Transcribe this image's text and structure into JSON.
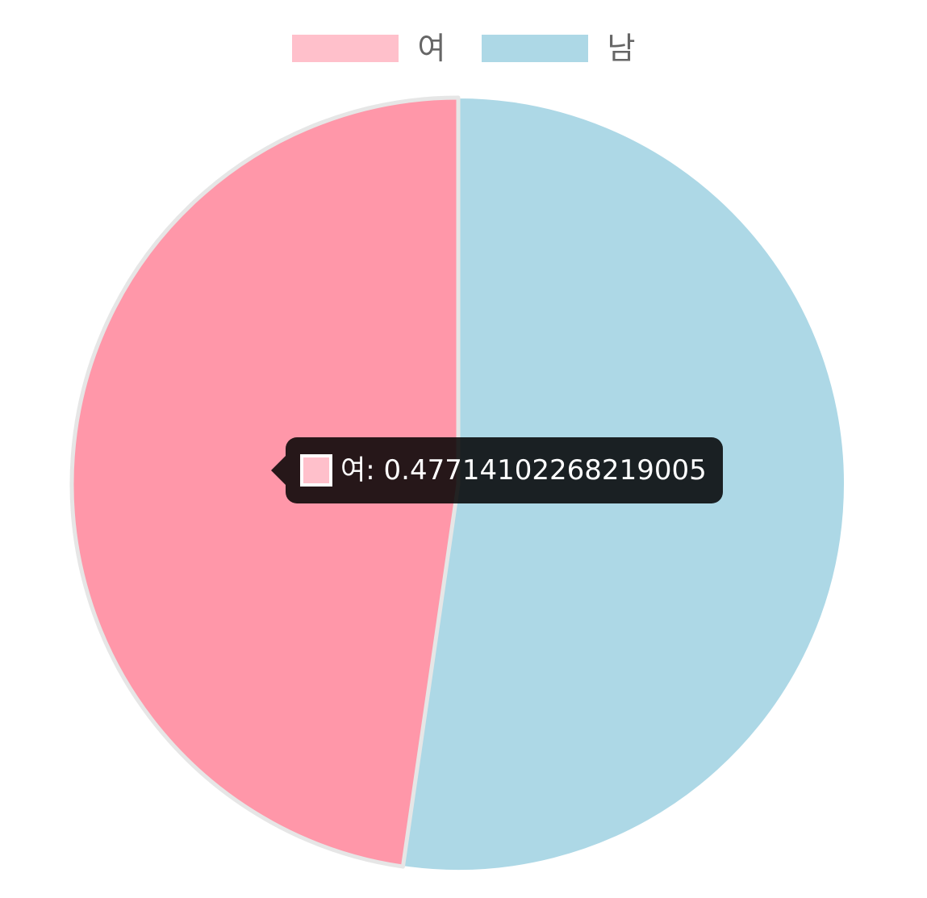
{
  "chart_data": {
    "type": "pie",
    "categories": [
      "여",
      "남"
    ],
    "values": [
      0.47714102268219005,
      0.52285897731781
    ],
    "colors": [
      "#ff97a9",
      "#add8e6"
    ],
    "legend_colors": [
      "#ffc0cb",
      "#add8e6"
    ],
    "border_color": "#e6e6e6",
    "start_angle_deg": -90,
    "direction": "counterclockwise",
    "legend_position": "top"
  },
  "tooltip": {
    "label": "여",
    "value": "0.47714102268219005",
    "text": "여: 0.47714102268219005",
    "swatch_color": "#ffc0cb"
  }
}
